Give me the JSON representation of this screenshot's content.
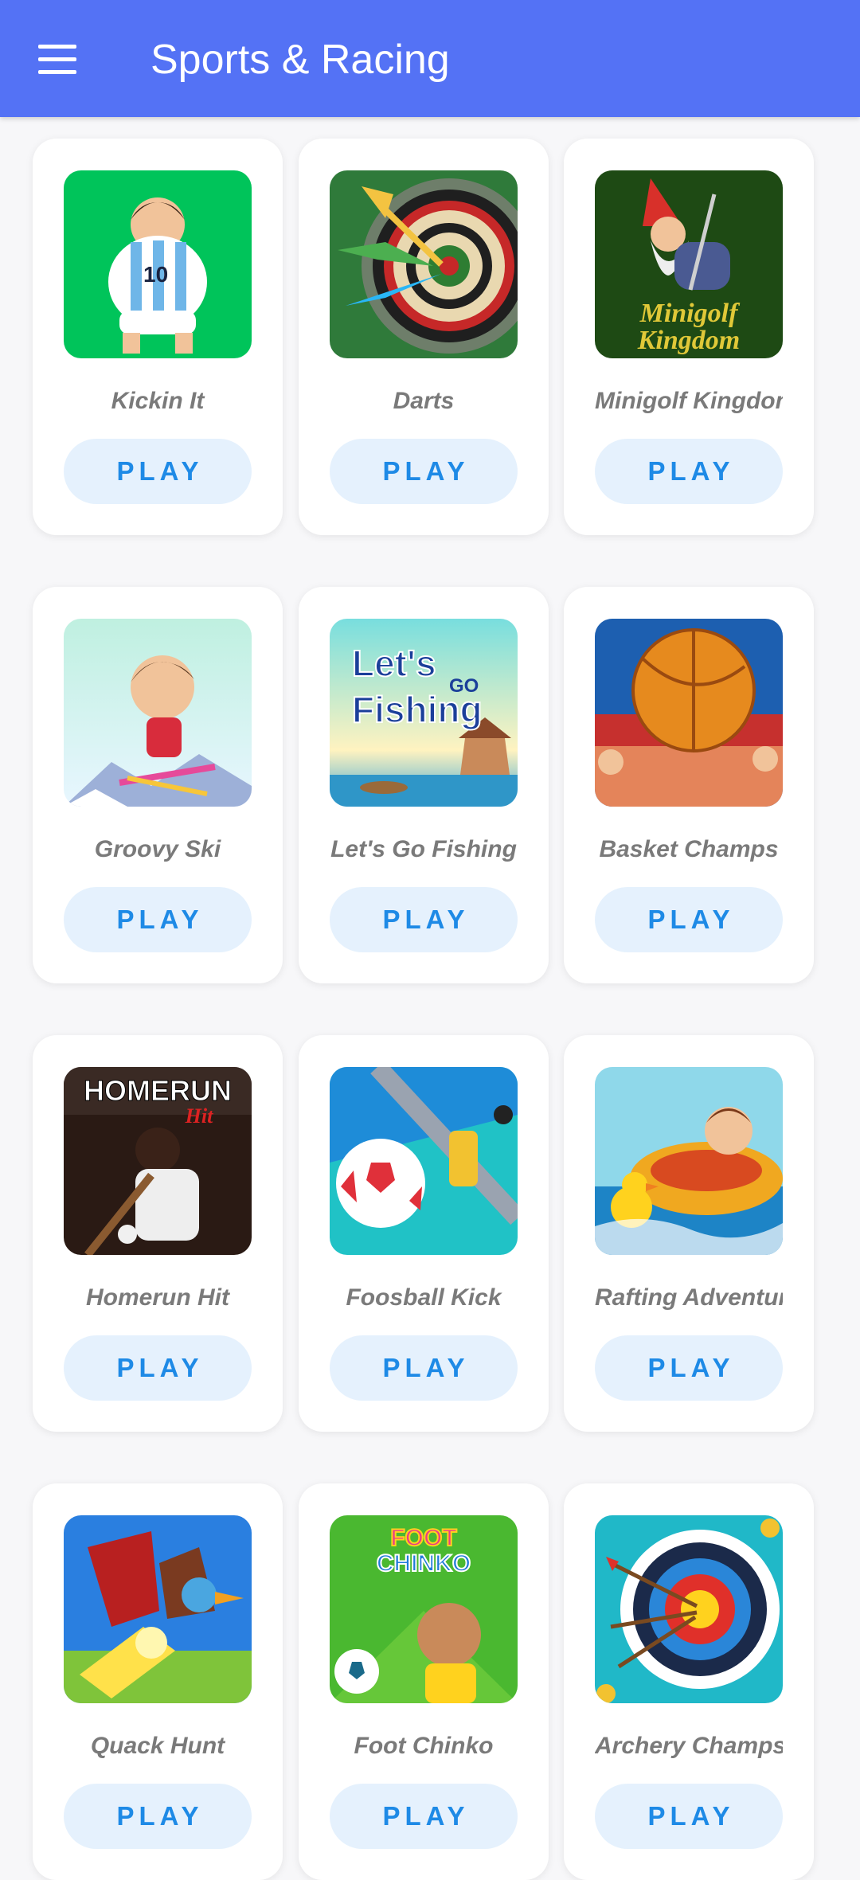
{
  "appbar": {
    "title": "Sports & Racing",
    "menu_icon": "hamburger-menu-icon",
    "color": "#5472f5"
  },
  "play_label": "PLAY",
  "games": [
    {
      "name": "Kickin It",
      "icon": "soccer-player-thumbnail"
    },
    {
      "name": "Darts",
      "icon": "dartboard-thumbnail"
    },
    {
      "name": "Minigolf Kingdom",
      "icon": "gnome-golfer-thumbnail",
      "logo_text": "Minigolf Kingdom"
    },
    {
      "name": "Groovy Ski",
      "icon": "skier-thumbnail"
    },
    {
      "name": "Let's Go Fishing",
      "icon": "fishing-thumbnail",
      "logo_text": "Let's Go Fishing"
    },
    {
      "name": "Basket Champs",
      "icon": "basketball-thumbnail"
    },
    {
      "name": "Homerun Hit",
      "icon": "baseball-batter-thumbnail",
      "logo_text": "HOMERUN Hit"
    },
    {
      "name": "Foosball Kick",
      "icon": "foosball-thumbnail"
    },
    {
      "name": "Rafting Adventure",
      "icon": "rafting-thumbnail"
    },
    {
      "name": "Quack Hunt",
      "icon": "duck-hunt-thumbnail"
    },
    {
      "name": "Foot Chinko",
      "icon": "foot-chinko-thumbnail",
      "logo_text": "FOOT CHINKO"
    },
    {
      "name": "Archery Champs",
      "icon": "archery-target-thumbnail"
    }
  ]
}
